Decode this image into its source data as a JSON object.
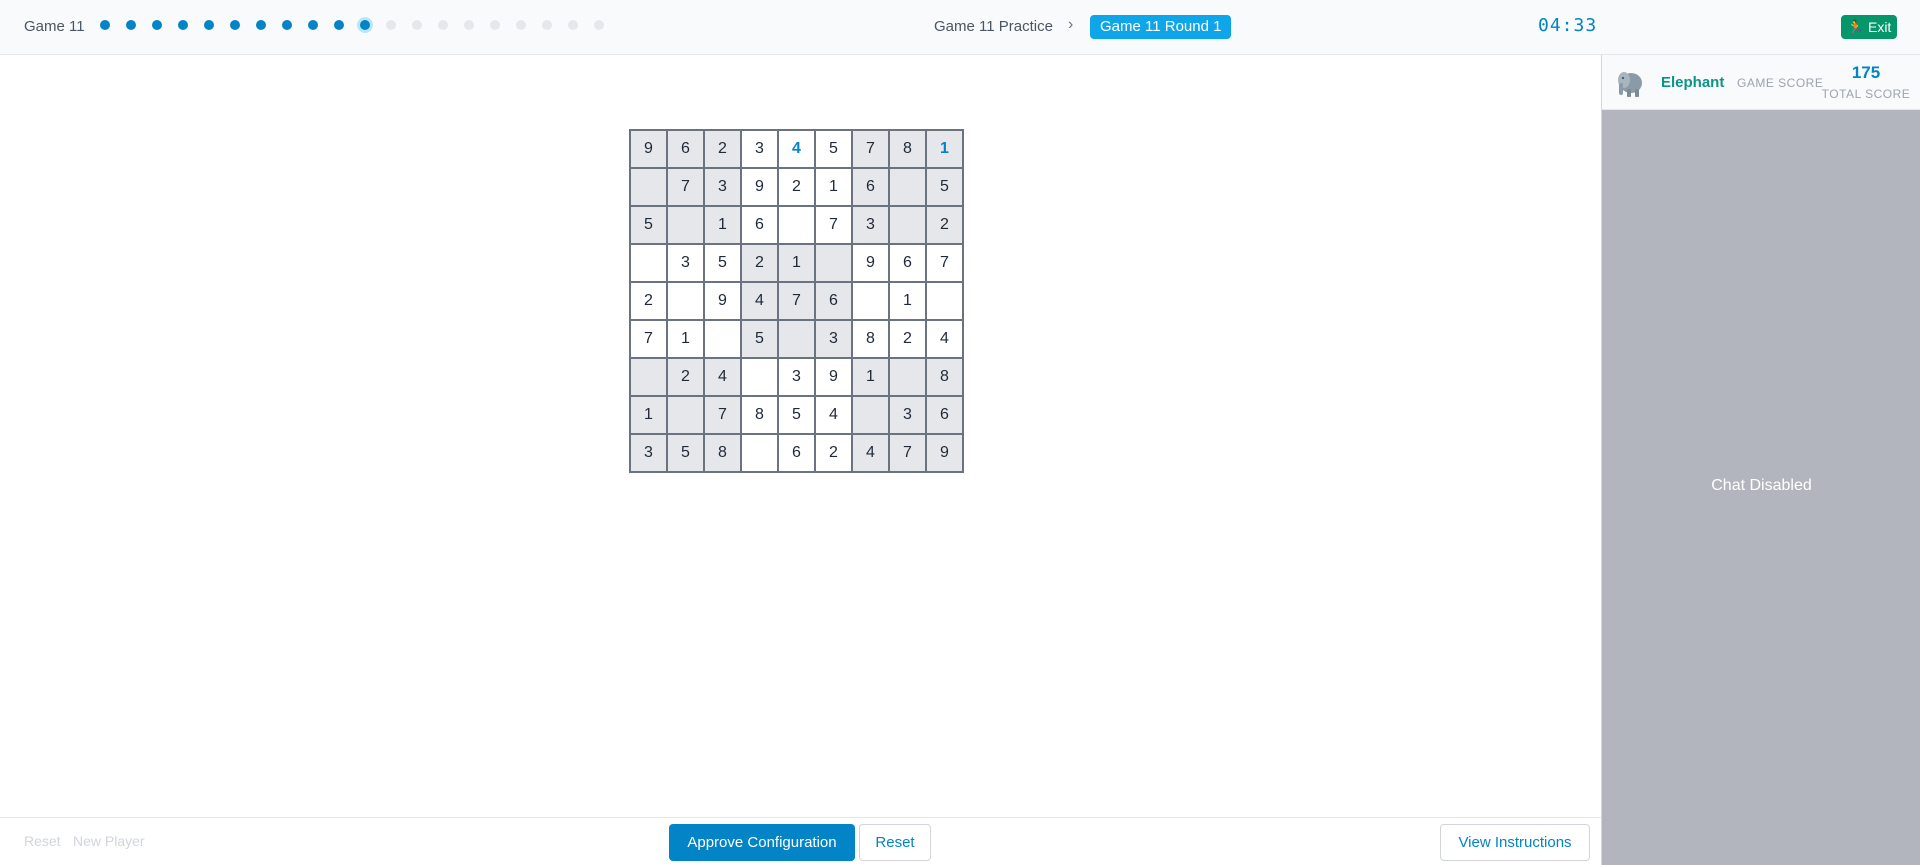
{
  "header": {
    "game_label": "Game 11",
    "progress": {
      "completed": 10,
      "current": 1,
      "pending": 9
    },
    "breadcrumb": {
      "parent": "Game 11 Practice",
      "separator": "›",
      "active": "Game 11 Round 1"
    },
    "timer": "04:33",
    "exit_label": "Exit"
  },
  "board": {
    "rows": [
      [
        "9",
        "6",
        "2",
        "3",
        "4",
        "5",
        "7",
        "8",
        "1"
      ],
      [
        "",
        "7",
        "3",
        "9",
        "2",
        "1",
        "6",
        "",
        "5"
      ],
      [
        "5",
        "",
        "1",
        "6",
        "",
        "7",
        "3",
        "",
        "2"
      ],
      [
        "",
        "3",
        "5",
        "2",
        "1",
        "",
        "9",
        "6",
        "7"
      ],
      [
        "2",
        "",
        "9",
        "4",
        "7",
        "6",
        "",
        "1",
        ""
      ],
      [
        "7",
        "1",
        "",
        "5",
        "",
        "3",
        "8",
        "2",
        "4"
      ],
      [
        "",
        "2",
        "4",
        "",
        "3",
        "9",
        "1",
        "",
        "8"
      ],
      [
        "1",
        "",
        "7",
        "8",
        "5",
        "4",
        "",
        "3",
        "6"
      ],
      [
        "3",
        "5",
        "8",
        "",
        "6",
        "2",
        "4",
        "7",
        "9"
      ]
    ],
    "highlighted_cells": [
      [
        0,
        4
      ],
      [
        0,
        8
      ]
    ],
    "highlight_color": "#0284c7",
    "shaded_color": "#e5e7eb"
  },
  "footer": {
    "reset_link": "Reset",
    "new_player_link": "New Player",
    "approve_label": "Approve Configuration",
    "reset_label": "Reset",
    "instructions_label": "View Instructions"
  },
  "sidebar": {
    "player_name": "Elephant",
    "game_score_label": "GAME SCORE",
    "total_score": "175",
    "total_score_label": "TOTAL SCORE",
    "chat_status": "Chat Disabled",
    "avatar_icon": "elephant-icon"
  },
  "colors": {
    "accent": "#0284c7",
    "exit": "#059669",
    "sidebar": "#b2b5bd",
    "player_name": "#0d9488"
  }
}
